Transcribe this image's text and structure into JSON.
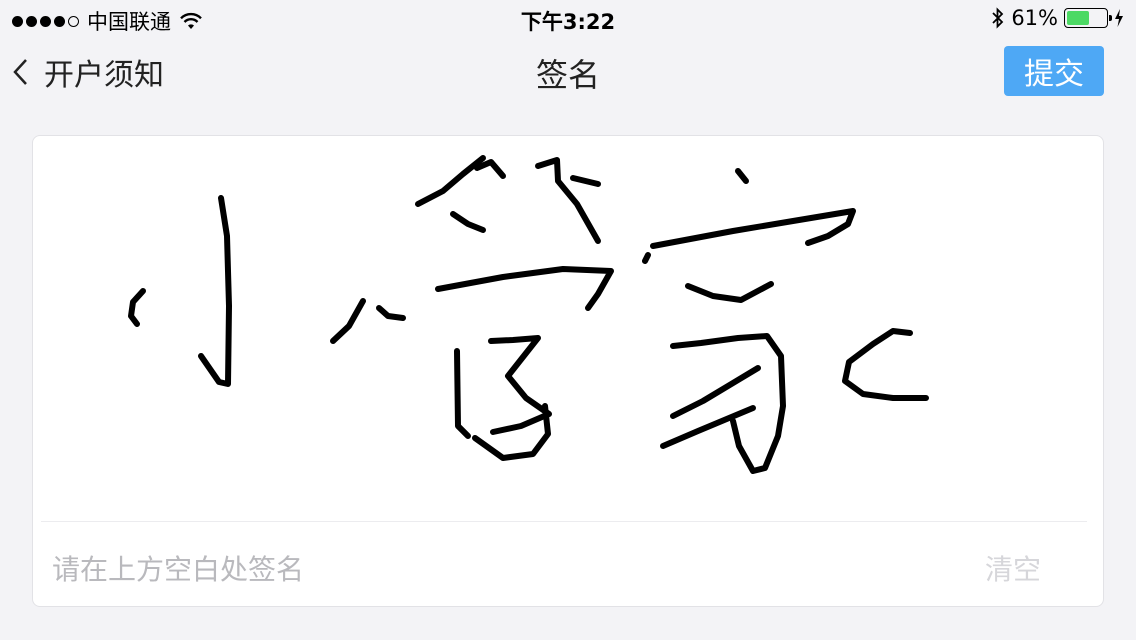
{
  "status_bar": {
    "carrier": "中国联通",
    "time": "下午3:22",
    "battery_percent": "61%",
    "battery_level": 0.61,
    "signal_bars_filled": 4,
    "signal_bars_total": 5,
    "icons": [
      "wifi-icon",
      "bluetooth-icon",
      "battery-icon",
      "charging-icon"
    ]
  },
  "nav": {
    "back_label": "开户须知",
    "title": "签名",
    "submit_label": "提交",
    "accent_color": "#4ea8f5"
  },
  "signature_pad": {
    "hint": "请在上方空白处签名",
    "clear_label": "清空"
  }
}
